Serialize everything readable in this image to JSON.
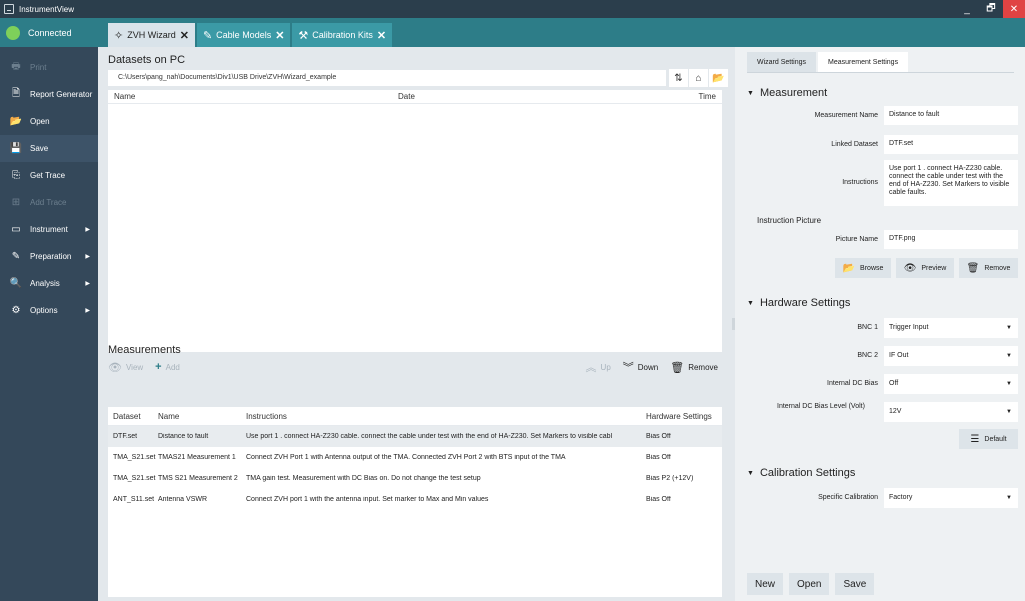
{
  "window": {
    "title": "InstrumentView",
    "controls": [
      "_",
      "🗗",
      "✕"
    ]
  },
  "sidebar": {
    "status": "Connected",
    "items": [
      {
        "label": "Print",
        "icon": "print-icon",
        "disabled": true
      },
      {
        "label": "Report Generator",
        "icon": "report-icon",
        "disabled": false
      },
      {
        "label": "Open",
        "icon": "open-icon",
        "disabled": false
      },
      {
        "label": "Save",
        "icon": "save-icon",
        "disabled": false,
        "active": true
      },
      {
        "label": "Get Trace",
        "icon": "get-trace-icon",
        "disabled": false
      },
      {
        "label": "Add Trace",
        "icon": "add-trace-icon",
        "disabled": true
      },
      {
        "label": "Instrument",
        "icon": "instrument-icon",
        "disabled": false,
        "submenu": true
      },
      {
        "label": "Preparation",
        "icon": "pen-icon",
        "disabled": false,
        "submenu": true
      },
      {
        "label": "Analysis",
        "icon": "analysis-icon",
        "disabled": false,
        "submenu": true
      },
      {
        "label": "Options",
        "icon": "options-icon",
        "disabled": false,
        "submenu": true
      }
    ]
  },
  "tabs": [
    {
      "label": "ZVH Wizard",
      "active": true
    },
    {
      "label": "Cable Models",
      "active": false
    },
    {
      "label": "Calibration Kits",
      "active": false
    }
  ],
  "datasets": {
    "title": "Datasets on PC",
    "path": "C:\\Users\\pang_nah\\Documents\\Div1\\USB Drive\\ZVH\\Wizard_example",
    "columns": [
      "Name",
      "Date",
      "Time"
    ]
  },
  "actions": {
    "view": "View",
    "add": "Add",
    "up": "Up",
    "down": "Down",
    "remove": "Remove"
  },
  "measurements": {
    "title": "Measurements",
    "columns": [
      "Dataset",
      "Name",
      "Instructions",
      "Hardware Settings"
    ],
    "rows": [
      {
        "dataset": "DTF.set",
        "name": "Distance to fault",
        "instructions": "Use port 1 . connect HA-Z230 cable. connect the cable under test with the end of HA-Z230. Set Markers to visible cabl",
        "hardware": "Bias Off"
      },
      {
        "dataset": "TMA_S21.set",
        "name": "TMAS21 Measurement 1",
        "instructions": "Connect ZVH Port 1 with Antenna output of the TMA. Connected ZVH Port 2 with BTS input of the TMA",
        "hardware": "Bias Off"
      },
      {
        "dataset": "TMA_S21.set",
        "name": "TMS S21 Measurement 2",
        "instructions": "TMA gain test. Measurement with DC Bias on. Do not change the test setup",
        "hardware": "Bias P2 (+12V)"
      },
      {
        "dataset": "ANT_S11.set",
        "name": "Antenna VSWR",
        "instructions": "Connect ZVH port 1 with the antenna input. Set marker to Max and Min values",
        "hardware": "Bias Off"
      }
    ]
  },
  "right_panel": {
    "tabs": [
      "Wizard Settings",
      "Measurement Settings"
    ],
    "measurement": {
      "title": "Measurement",
      "name_label": "Measurement Name",
      "name_value": "Distance to fault",
      "linked_label": "Linked Dataset",
      "linked_value": "DTF.set",
      "instructions_label": "Instructions",
      "instructions_value": "Use port 1 . connect HA-Z230 cable. connect the cable under test with the end of HA-Z230. Set Markers to visible cable faults.",
      "picture_title": "Instruction Picture",
      "picture_label": "Picture Name",
      "picture_value": "DTF.png",
      "browse": "Browse",
      "preview": "Preview",
      "remove": "Remove"
    },
    "hardware": {
      "title": "Hardware Settings",
      "bnc1_label": "BNC 1",
      "bnc1_value": "Trigger Input",
      "bnc2_label": "BNC 2",
      "bnc2_value": "IF Out",
      "dcbias_label": "Internal DC Bias",
      "dcbias_value": "Off",
      "dclevel_label": "Internal DC Bias Level (Volt)",
      "dclevel_value": "12V",
      "default": "Default"
    },
    "calibration": {
      "title": "Calibration Settings",
      "specific_label": "Specific Calibration",
      "specific_value": "Factory"
    },
    "bottom": {
      "new": "New",
      "open": "Open",
      "save": "Save"
    }
  }
}
